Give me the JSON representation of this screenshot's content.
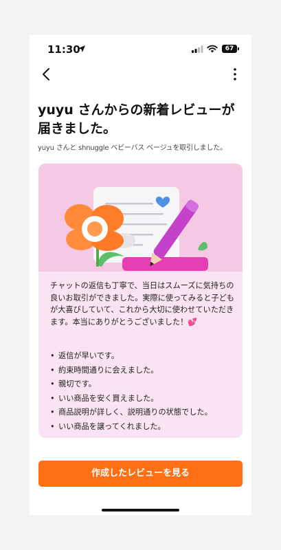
{
  "status_bar": {
    "time": "11:30",
    "battery": "67"
  },
  "header": {
    "title": "yuyu さんからの新着レビューが届きました。",
    "subtitle": "yuyu さんと shnuggle ベビーバス ベージュを取引しました。"
  },
  "review": {
    "text": "チャットの返信も丁寧で、当日はスムーズに気持ちの良いお取引ができました。実際に使ってみると子どもが大喜びしていて、これから大切に使わせていただきます。本当にありがとうございました！💕",
    "tags": [
      "返信が早いです。",
      "約束時間通りに会えました。",
      "親切です。",
      "いい商品を安く買えました。",
      "商品説明が詳しく、説明通りの状態でした。",
      "いい商品を譲ってくれました。"
    ]
  },
  "cta": {
    "label": "作成したレビューを見る"
  },
  "colors": {
    "accent": "#ff6f15",
    "card_bg": "#fae3f2",
    "illustration_bg": "#f5c8e4"
  },
  "icons": [
    "location-arrow-icon",
    "signal-icon",
    "wifi-icon",
    "battery-icon",
    "back-chevron-icon",
    "more-vertical-icon"
  ]
}
